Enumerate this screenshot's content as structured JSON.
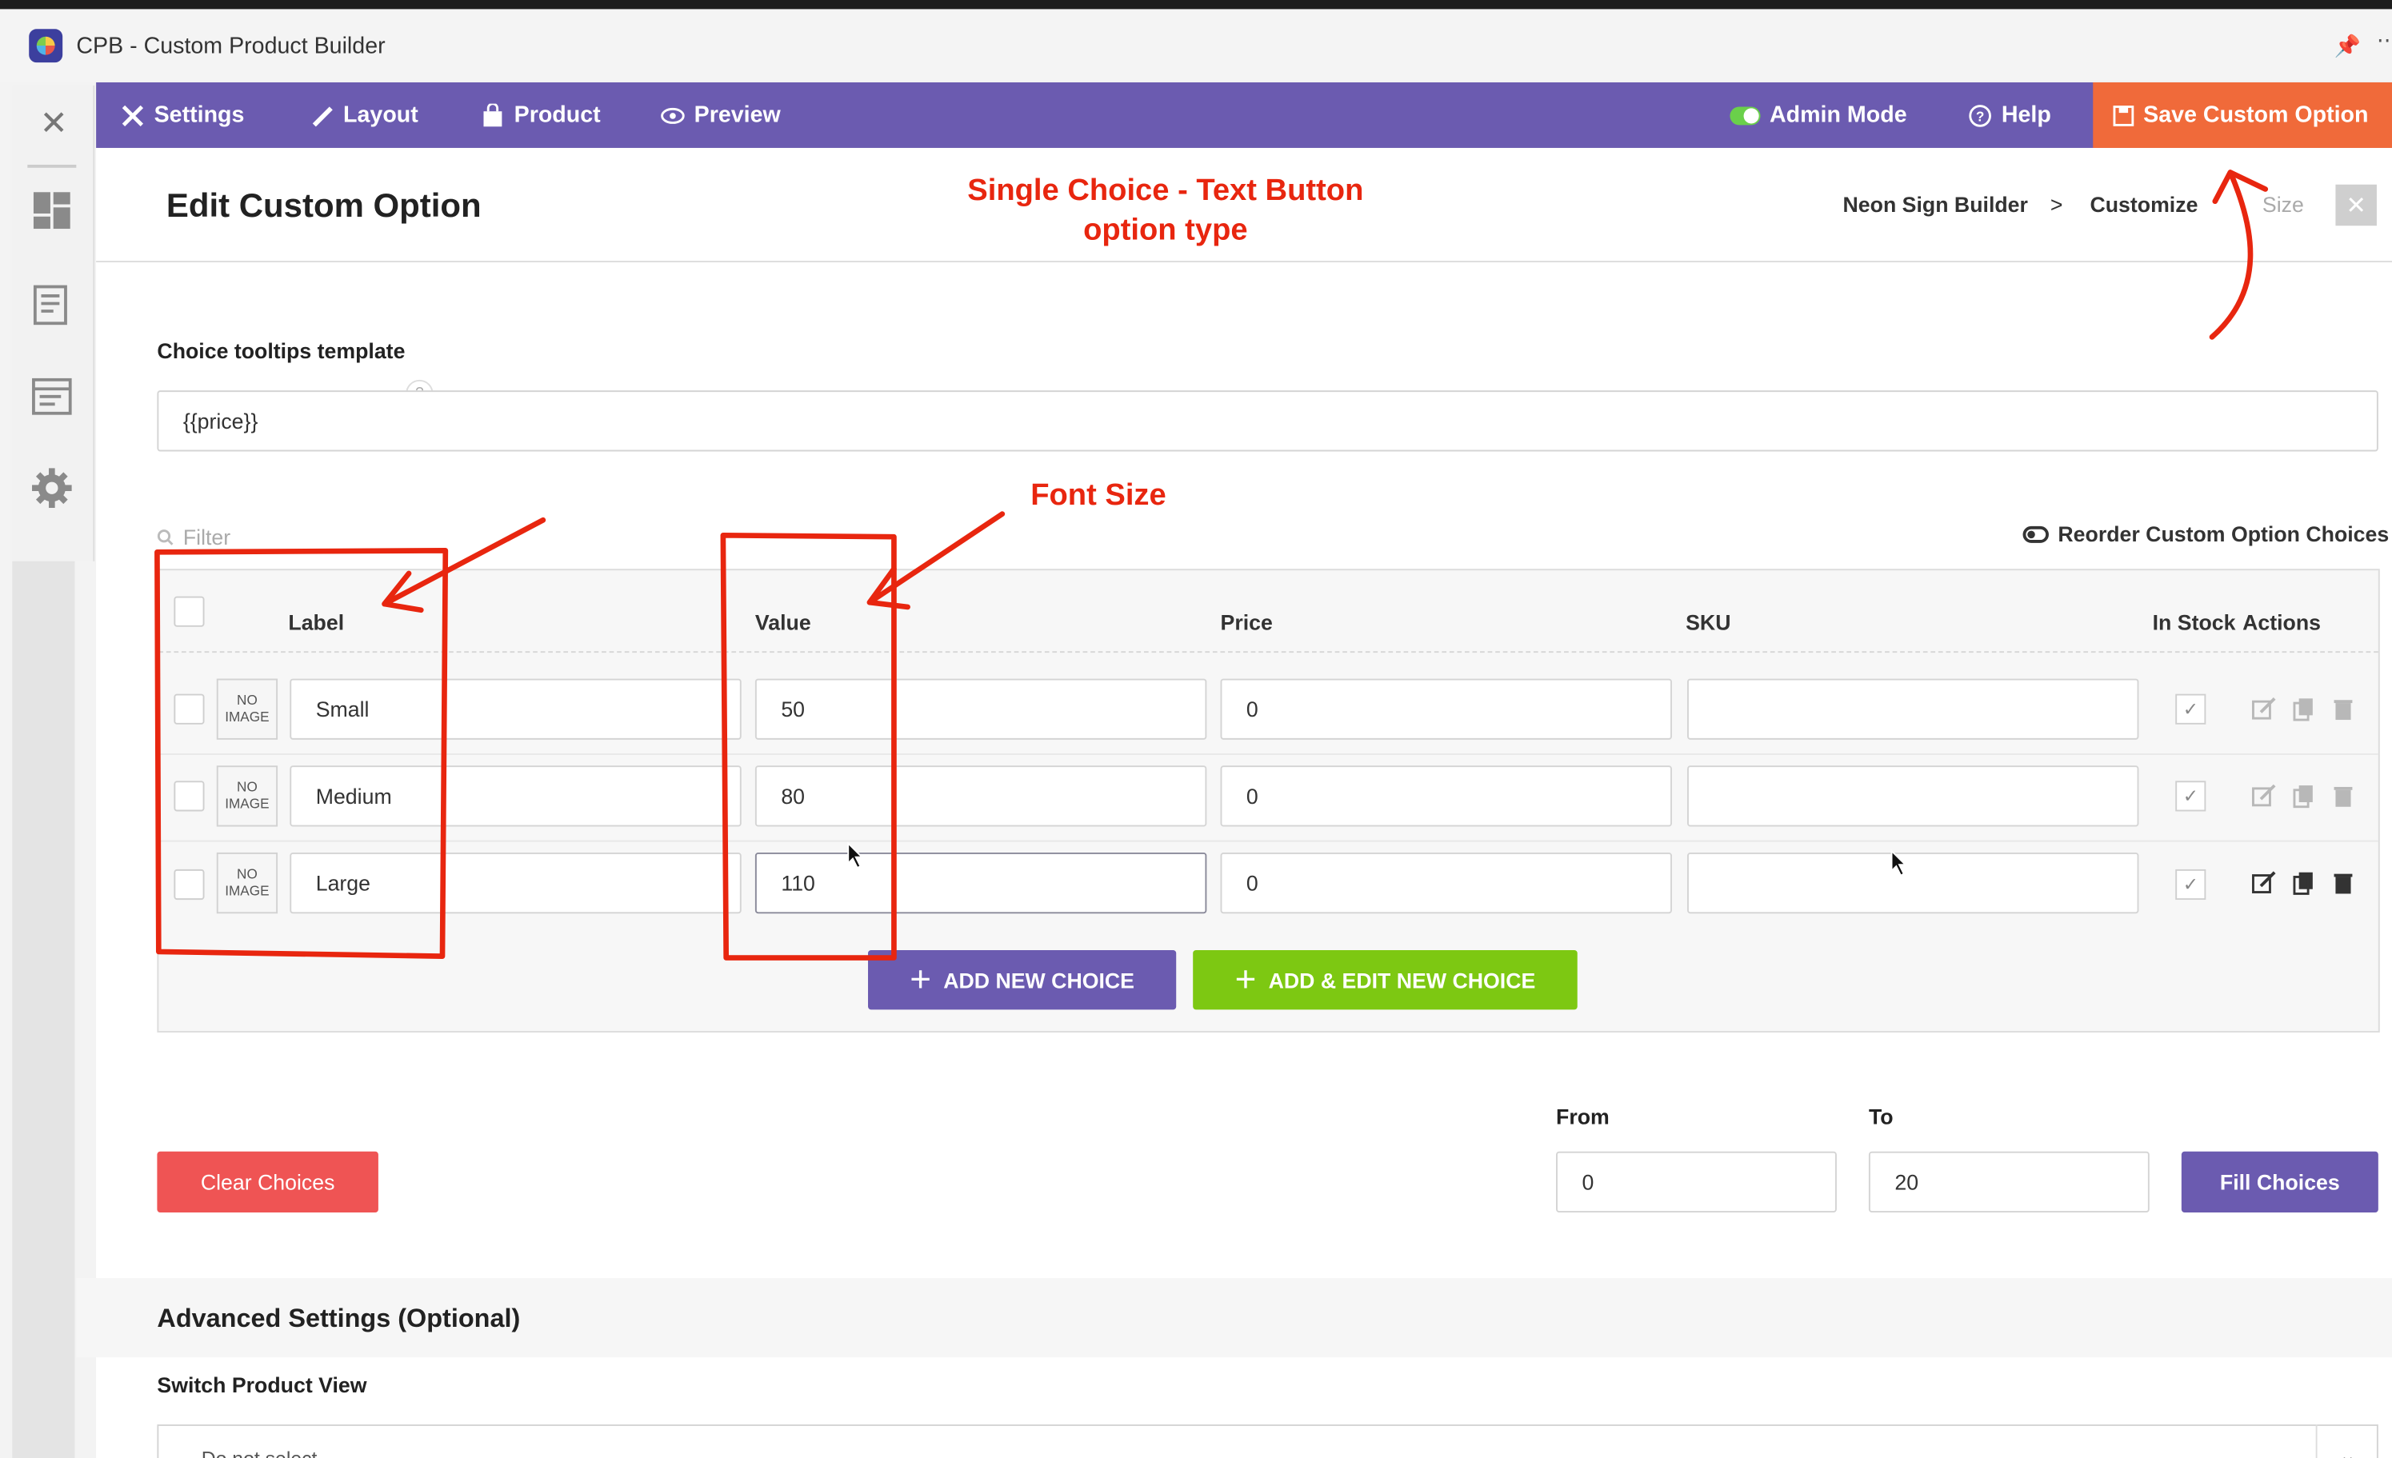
{
  "window": {
    "title": "CPB - Custom Product Builder"
  },
  "navbar": {
    "settings": "Settings",
    "layout": "Layout",
    "product": "Product",
    "preview": "Preview",
    "admin_mode": "Admin Mode",
    "help": "Help",
    "save": "Save Custom Option"
  },
  "page": {
    "title": "Edit Custom Option",
    "breadcrumbs": [
      "Neon Sign Builder",
      ">",
      "Customize",
      "Size"
    ]
  },
  "annotations": {
    "top_line1": "Single Choice - Text Button",
    "top_line2": "option type",
    "font_size": "Font Size",
    "color": "#e8260f"
  },
  "tooltip_template": {
    "label": "Choice tooltips template",
    "help": "?",
    "value": "{{price}}"
  },
  "filter": {
    "placeholder": "Filter"
  },
  "reorder_label": "Reorder Custom Option Choices",
  "table": {
    "headers": {
      "label": "Label",
      "value": "Value",
      "price": "Price",
      "sku": "SKU",
      "in_stock": "In Stock",
      "actions": "Actions"
    },
    "no_image_1": "NO",
    "no_image_2": "IMAGE",
    "rows": [
      {
        "label": "Small",
        "value": "50",
        "price": "0",
        "sku": "",
        "in_stock": true
      },
      {
        "label": "Medium",
        "value": "80",
        "price": "0",
        "sku": "",
        "in_stock": true
      },
      {
        "label": "Large",
        "value": "110",
        "price": "0",
        "sku": "",
        "in_stock": true
      }
    ],
    "add_choice": "ADD NEW CHOICE",
    "add_edit_choice": "ADD & EDIT NEW CHOICE"
  },
  "fill": {
    "clear": "Clear Choices",
    "from_label": "From",
    "from_value": "0",
    "to_label": "To",
    "to_value": "20",
    "fill_button": "Fill Choices"
  },
  "advanced": {
    "title": "Advanced Settings (Optional)",
    "switch_label": "Switch Product View",
    "select_value": "Do not select"
  },
  "colors": {
    "nav": "#6b5bb0",
    "save": "#f06a3a",
    "add": "#6b5bb0",
    "add_edit": "#7dc812",
    "clear": "#ef5454"
  }
}
